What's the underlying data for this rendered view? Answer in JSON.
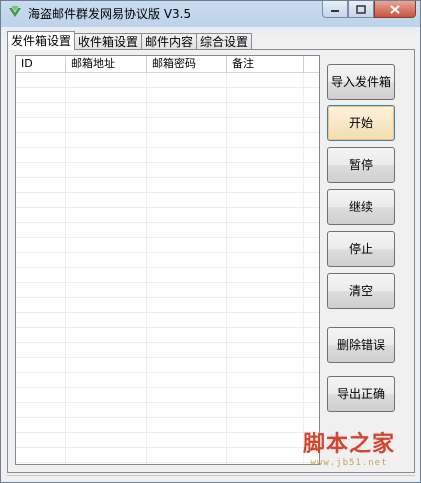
{
  "window": {
    "title": "海盗邮件群发网易协议版 V3.5"
  },
  "tabs": [
    "发件箱设置",
    "收件箱设置",
    "邮件内容",
    "综合设置"
  ],
  "listview": {
    "columns": [
      "ID",
      "邮箱地址",
      "邮箱密码",
      "备注"
    ]
  },
  "buttons": {
    "import": "导入发件箱",
    "start": "开始",
    "pause": "暂停",
    "resume": "继续",
    "stop": "停止",
    "clear": "清空",
    "delete_errors": "删除错误",
    "export_correct": "导出正确"
  },
  "watermark": {
    "text": "脚本之家",
    "url": "www.jb51.net"
  }
}
